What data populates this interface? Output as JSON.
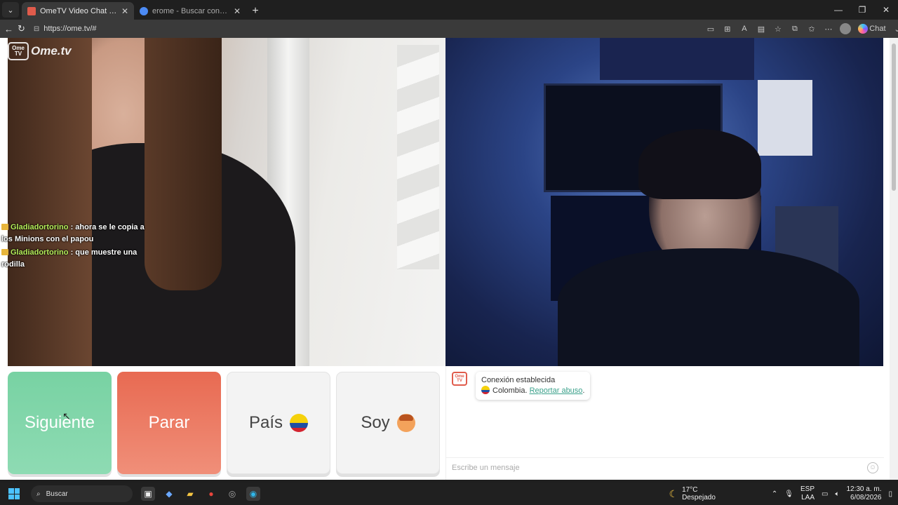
{
  "browser": {
    "tabs": [
      {
        "title": "OmeTV Video Chat — Omegl",
        "active": true
      },
      {
        "title": "erome - Buscar con Google",
        "active": false
      }
    ],
    "url": "https://ome.tv/#",
    "chat_button": "Chat"
  },
  "app": {
    "logo_icon_text": "Ome TV",
    "logo_text": "Ome.tv",
    "overlay_chat": [
      {
        "user": "Gladiadortorino",
        "text": ": ahora se le copia a los Minions con el papou"
      },
      {
        "user": "Gladiadortorino",
        "text": ": que muestre una rodilla"
      }
    ],
    "buttons": {
      "next": "Siguiente",
      "stop": "Parar",
      "country": "País",
      "gender": "Soy"
    },
    "chat": {
      "system_title": "Conexión establecida",
      "country": "Colombia.",
      "report_link": "Reportar abuso",
      "input_placeholder": "Escribe un mensaje"
    }
  },
  "taskbar": {
    "search_label": "Buscar",
    "weather_temp": "17°C",
    "weather_desc": "Despejado",
    "lang_1": "ESP",
    "lang_2": "LAA",
    "time": "12:30 a. m.",
    "date": "6/08/2026"
  },
  "colors": {
    "next_button": "#7fd5a8",
    "stop_button": "#ec7b63",
    "link": "#3ba18b"
  }
}
